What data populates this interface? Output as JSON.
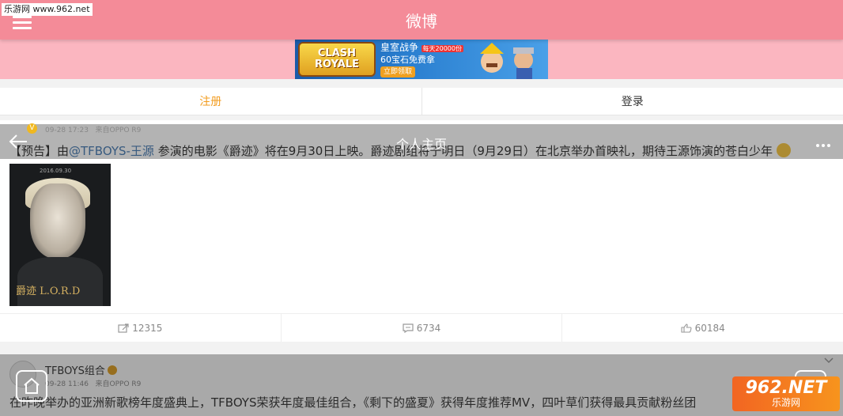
{
  "watermark_top": "乐游网 www.962.net",
  "header": {
    "title": "微博"
  },
  "ad": {
    "logo_text": "CLASH ROYALE",
    "line1": "皇室战争",
    "badge": "每天20000份",
    "line2": "60宝石免费拿",
    "button": "立即领取"
  },
  "tabs": {
    "register": "注册",
    "login": "登录"
  },
  "overlay": {
    "title": "个人主页"
  },
  "post1": {
    "time": "09-28 17:23",
    "source": "来自OPPO R9",
    "text_prefix": "【预告】由",
    "mention": "@TFBOYS-王源",
    "text_suffix": " 参演的电影《爵迹》将在9月30日上映。爵迹剧组将于明日（9月29日）在北京举办首映礼，期待王源饰演的苍白少年",
    "image": {
      "date": "2016.09.30",
      "title": "爵迹 L.O.R.D"
    },
    "repost_count": "12315",
    "comment_count": "6734",
    "like_count": "60184"
  },
  "post2": {
    "author": "TFBOYS组合",
    "time": "09-28 11:46",
    "source": "来自OPPO R9",
    "text": "在昨晚举办的亚洲新歌榜年度盛典上，TFBOYS荣获年度最佳组合，《剩下的盛夏》获得年度推荐MV，四叶草们获得最具贡献粉丝团"
  },
  "logo962": {
    "line1": "962.NET",
    "line2": "乐游网"
  },
  "colors": {
    "header": "#f48b98",
    "banner_bg": "#fbb6c0",
    "accent": "#f29c1f",
    "mention": "#4a7db3"
  }
}
